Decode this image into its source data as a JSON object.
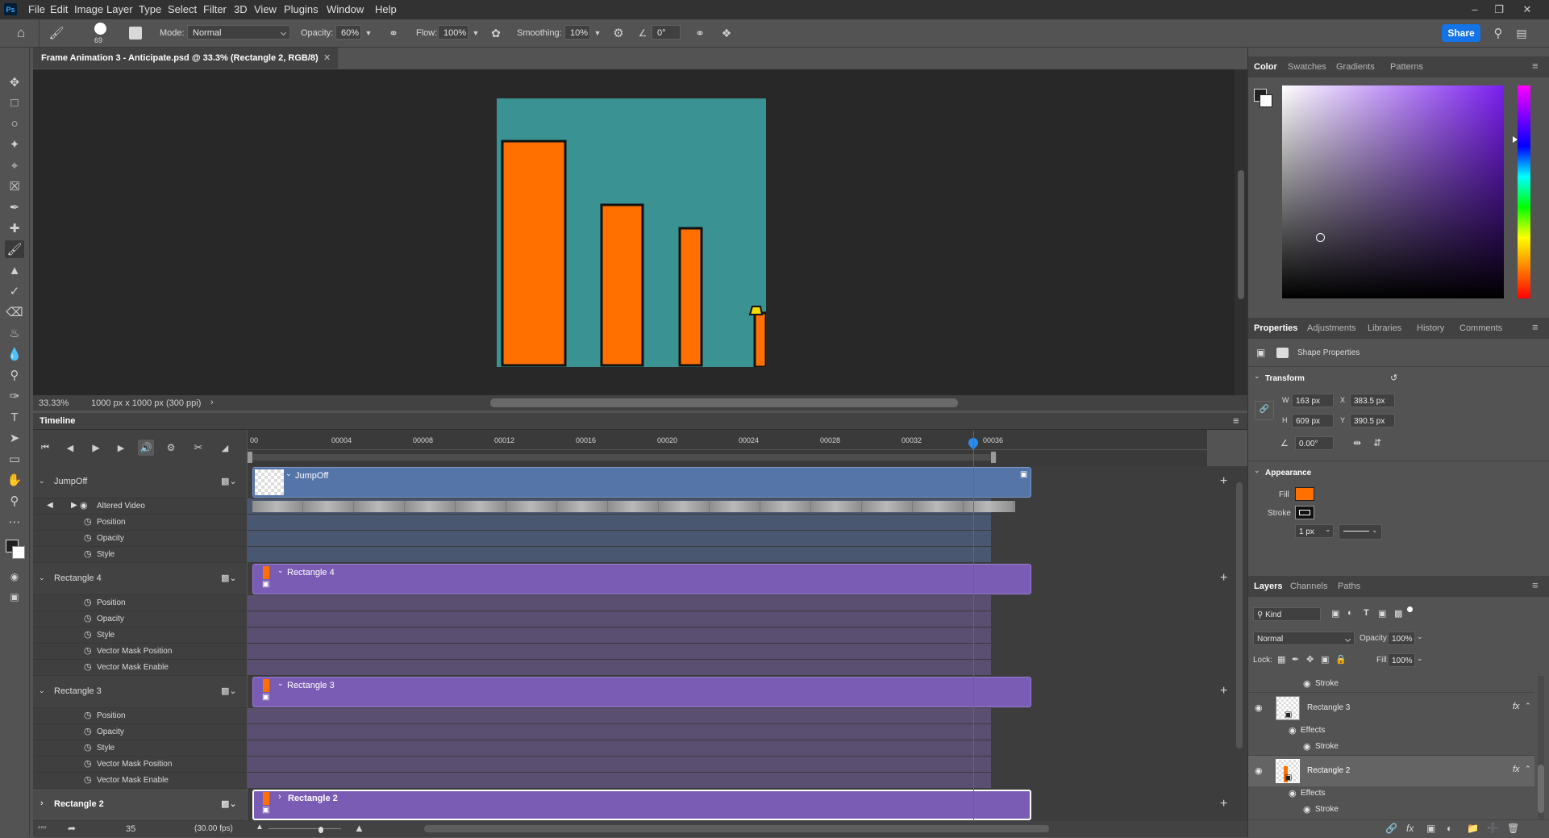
{
  "app": {
    "logo": "Ps"
  },
  "menu": [
    "File",
    "Edit",
    "Image",
    "Layer",
    "Type",
    "Select",
    "Filter",
    "3D",
    "View",
    "Plugins",
    "Window",
    "Help"
  ],
  "options": {
    "brush_size": "69",
    "mode_label": "Mode:",
    "mode_value": "Normal",
    "opacity_label": "Opacity:",
    "opacity_value": "60%",
    "flow_label": "Flow:",
    "flow_value": "100%",
    "smoothing_label": "Smoothing:",
    "smoothing_value": "10%",
    "angle_value": "0°",
    "share_label": "Share"
  },
  "document": {
    "tab_title": "Frame Animation 3 - Anticipate.psd @ 33.3% (Rectangle 2, RGB/8)",
    "zoom": "33.33%",
    "doc_info": "1000 px x 1000 px (300 ppi)",
    "canvas_bg": "#3a9292",
    "shape_fill": "#ff7000",
    "accent_yellow": "#f5d800"
  },
  "timeline": {
    "title": "Timeline",
    "ruler_labels": [
      "00",
      "00004",
      "00008",
      "00012",
      "00016",
      "00020",
      "00024",
      "00028",
      "00032",
      "00036"
    ],
    "playhead_frame": "35",
    "fps": "(30.00 fps)",
    "layers": [
      {
        "name": "JumpOff",
        "clip": "JumpOff",
        "kind": "video",
        "props": [
          "Altered Video",
          "Position",
          "Opacity",
          "Style"
        ]
      },
      {
        "name": "Rectangle 4",
        "clip": "Rectangle 4",
        "kind": "shape",
        "props": [
          "Position",
          "Opacity",
          "Style",
          "Vector Mask Position",
          "Vector Mask Enable"
        ]
      },
      {
        "name": "Rectangle 3",
        "clip": "Rectangle 3",
        "kind": "shape",
        "props": [
          "Position",
          "Opacity",
          "Style",
          "Vector Mask Position",
          "Vector Mask Enable"
        ]
      },
      {
        "name": "Rectangle 2",
        "clip": "Rectangle 2",
        "kind": "shape",
        "props": []
      }
    ]
  },
  "color_panel": {
    "tabs": [
      "Color",
      "Swatches",
      "Gradients",
      "Patterns"
    ]
  },
  "properties_panel": {
    "tabs": [
      "Properties",
      "Adjustments",
      "Libraries",
      "History",
      "Comments"
    ],
    "subtitle": "Shape Properties",
    "transform_label": "Transform",
    "w_label": "W",
    "w_value": "163 px",
    "h_label": "H",
    "h_value": "609 px",
    "x_label": "X",
    "x_value": "383.5 px",
    "y_label": "Y",
    "y_value": "390.5 px",
    "angle_value": "0.00°",
    "appearance_label": "Appearance",
    "fill_label": "Fill",
    "stroke_label": "Stroke",
    "stroke_width": "1 px"
  },
  "layers_panel": {
    "tabs": [
      "Layers",
      "Channels",
      "Paths"
    ],
    "kind_label": "Kind",
    "blend_mode": "Normal",
    "opacity_label": "Opacity:",
    "opacity_value": "100%",
    "lock_label": "Lock:",
    "fill_label": "Fill:",
    "fill_value": "100%",
    "rows": [
      {
        "name": "Stroke",
        "type": "effect-sub"
      },
      {
        "name": "Rectangle 3",
        "type": "layer"
      },
      {
        "name": "Effects",
        "type": "effect"
      },
      {
        "name": "Stroke",
        "type": "effect-sub"
      },
      {
        "name": "Rectangle 2",
        "type": "layer"
      },
      {
        "name": "Effects",
        "type": "effect"
      },
      {
        "name": "Stroke",
        "type": "effect-sub"
      }
    ],
    "fx_label": "fx"
  }
}
